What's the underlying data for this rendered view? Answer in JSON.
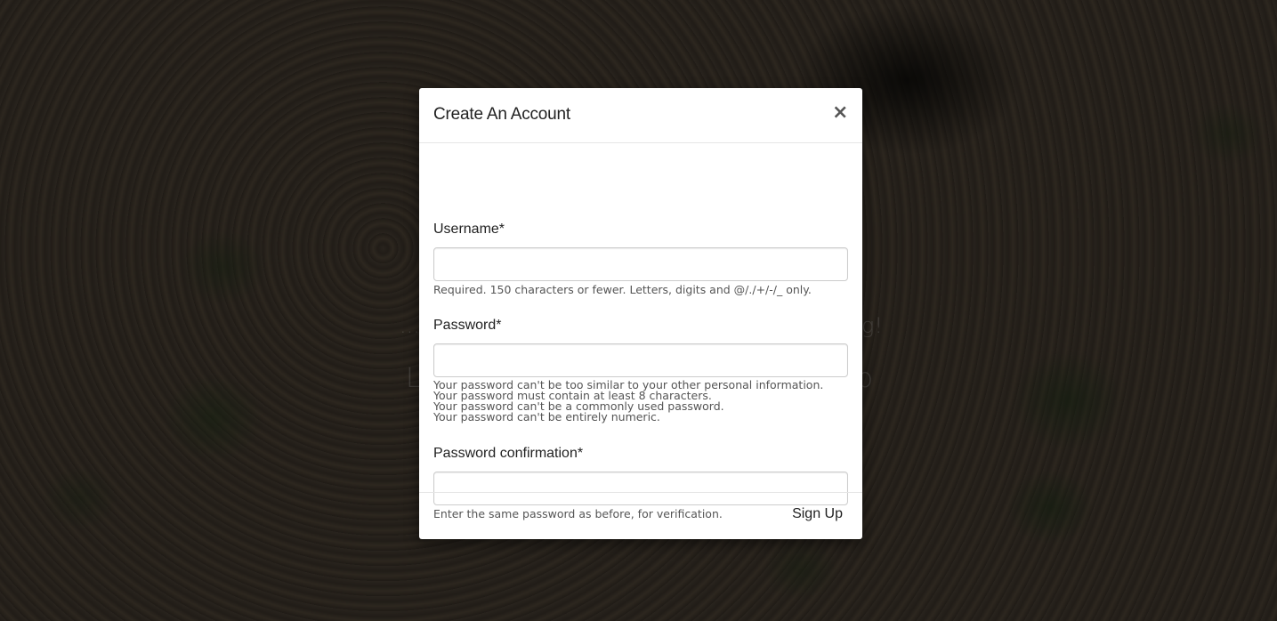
{
  "background": {
    "hero_line_1_start": "...t",
    "hero_line_1_end": "g!",
    "hero_line_2_start": "L",
    "hero_line_2_end": "p"
  },
  "modal": {
    "title": "Create An Account",
    "close_label": "×",
    "fields": [
      {
        "label": "Username*",
        "value": "",
        "help": "Required. 150 characters or fewer. Letters, digits and @/./+/-/_ only."
      },
      {
        "label": "Password*",
        "value": "",
        "help_items": [
          "Your password can't be too similar to your other personal information.",
          "Your password must contain at least 8 characters.",
          "Your password can't be a commonly used password.",
          "Your password can't be entirely numeric."
        ]
      },
      {
        "label": "Password confirmation*",
        "value": "",
        "help": "Enter the same password as before, for verification."
      }
    ],
    "submit_label": "Sign Up"
  }
}
